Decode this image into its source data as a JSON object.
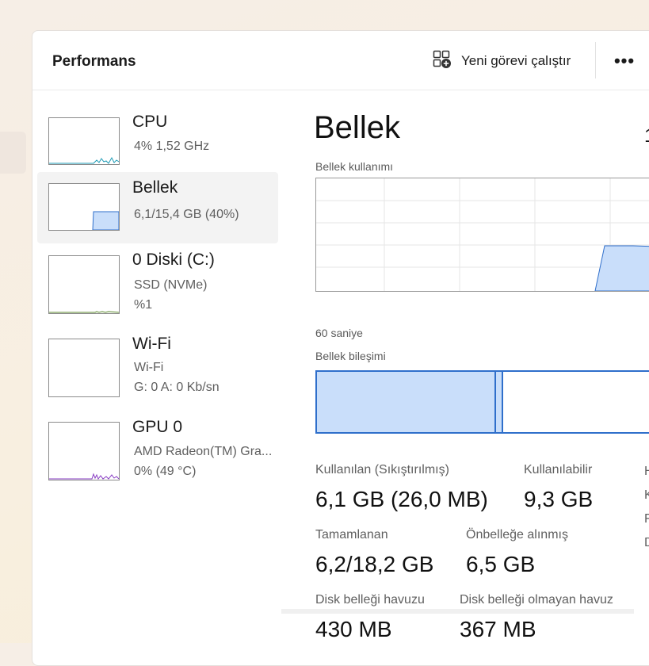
{
  "header": {
    "title": "Performans",
    "run_task_label": "Yeni görevi çalıştır",
    "more_label": "•••"
  },
  "sidebar": {
    "items": [
      {
        "name": "CPU",
        "line1": "4%  1,52 GHz",
        "line2": "",
        "selected": false,
        "color": "#1f9bb5"
      },
      {
        "name": "Bellek",
        "line1": "6,1/15,4 GB (40%)",
        "line2": "",
        "selected": true,
        "color": "#2f6fcb"
      },
      {
        "name": "0 Diski (C:)",
        "line1": "SSD (NVMe)",
        "line2": "%1",
        "selected": false,
        "color": "#5b8a2e"
      },
      {
        "name": "Wi-Fi",
        "line1": "Wi-Fi",
        "line2": "G: 0  A: 0 Kb/sn",
        "selected": false,
        "color": "#b06a14"
      },
      {
        "name": "GPU 0",
        "line1": "AMD Radeon(TM) Gra...",
        "line2": "0%  (49 °C)",
        "selected": false,
        "color": "#8a3fc4"
      }
    ]
  },
  "main": {
    "title": "Bellek",
    "title_right_partial": "1",
    "usage_caption": "Bellek kullanımı",
    "time_caption": "60 saniye",
    "composition_caption": "Bellek bileşimi",
    "stats": {
      "in_use_label": "Kullanılan (Sıkıştırılmış)",
      "in_use_value": "6,1 GB (26,0 MB)",
      "available_label": "Kullanılabilir",
      "available_value": "9,3 GB",
      "committed_label": "Tamamlanan",
      "committed_value": "6,2/18,2 GB",
      "cached_label": "Önbelleğe alınmış",
      "cached_value": "6,5 GB",
      "paged_label": "Disk belleği havuzu",
      "paged_value": "430 MB",
      "nonpaged_label": "Disk belleği olmayan havuz",
      "nonpaged_value": "367 MB"
    },
    "right_edge_letters": [
      "H",
      "K",
      "F",
      "D"
    ]
  },
  "colors": {
    "memory_fill": "#c9defa",
    "memory_stroke": "#2f6fcb",
    "grid": "#e6e6e6"
  }
}
